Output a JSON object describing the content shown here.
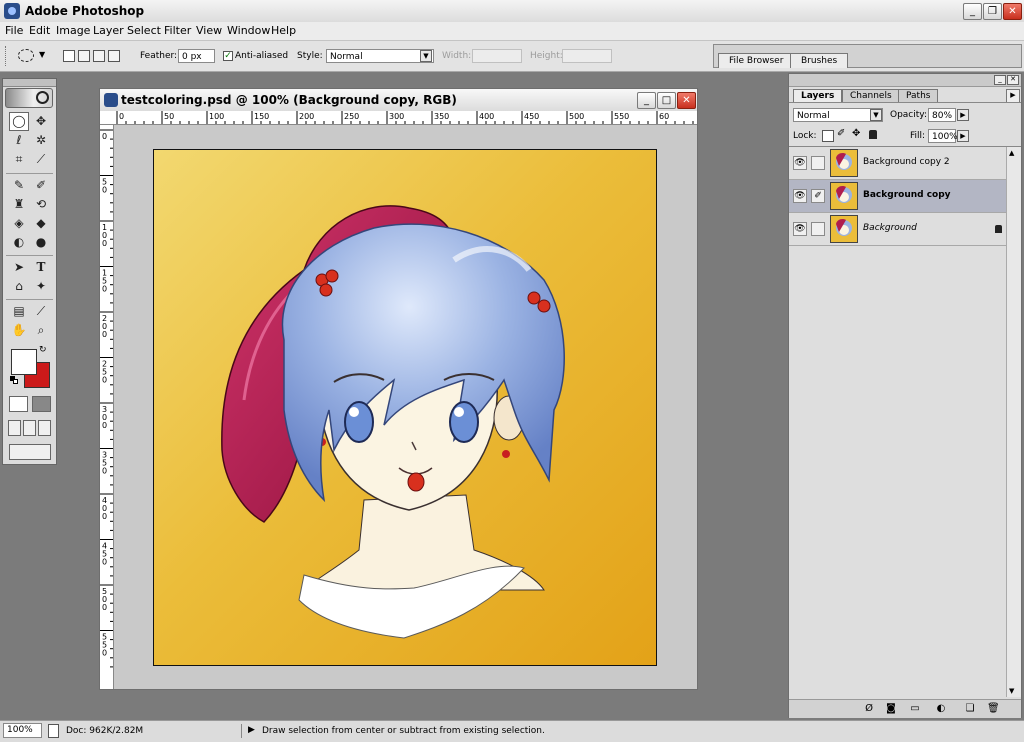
{
  "window": {
    "title": "Adobe Photoshop"
  },
  "menu": [
    "File",
    "Edit",
    "Image",
    "Layer",
    "Select",
    "Filter",
    "View",
    "Window",
    "Help"
  ],
  "options": {
    "feather_label": "Feather:",
    "feather_value": "0 px",
    "anti_aliased_label": "Anti-aliased",
    "anti_aliased_checked": true,
    "style_label": "Style:",
    "style_value": "Normal",
    "width_label": "Width:",
    "height_label": "Height:"
  },
  "palette_well": {
    "tabs": [
      "File Browser",
      "Brushes"
    ]
  },
  "document": {
    "title": "testcoloring.psd @ 100% (Background copy, RGB)",
    "ruler_h_labels": [
      "0",
      "50",
      "100",
      "150",
      "200",
      "250",
      "300",
      "350",
      "400",
      "450",
      "500",
      "550",
      "60"
    ],
    "ruler_v_labels": [
      "0",
      "50",
      "100",
      "150",
      "200",
      "250",
      "300",
      "350",
      "400",
      "450",
      "500",
      "550"
    ]
  },
  "layers_panel": {
    "tabs": [
      "Layers",
      "Channels",
      "Paths"
    ],
    "blend_mode": "Normal",
    "opacity_label": "Opacity:",
    "opacity_value": "80%",
    "lock_label": "Lock:",
    "fill_label": "Fill:",
    "fill_value": "100%",
    "layers": [
      {
        "name": "Background copy 2",
        "selected": false
      },
      {
        "name": "Background copy",
        "selected": true
      },
      {
        "name": "Background",
        "selected": false
      }
    ]
  },
  "status": {
    "zoom": "100%",
    "doc_info": "Doc: 962K/2.82M",
    "hint": "Draw selection from center or subtract from existing selection."
  },
  "colors": {
    "foreground": "#ffffff",
    "background": "#cc1a1a",
    "canvas_bg": "#ebbd3a"
  }
}
